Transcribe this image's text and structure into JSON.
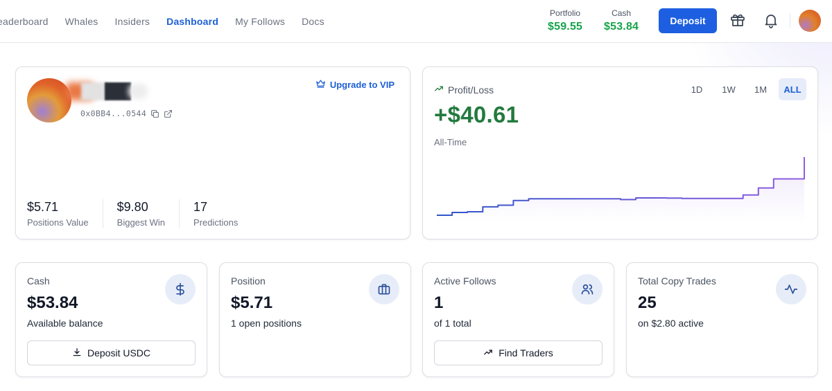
{
  "nav": {
    "links": [
      "eaderboard",
      "Whales",
      "Insiders",
      "Dashboard",
      "My Follows",
      "Docs"
    ],
    "active": "Dashboard"
  },
  "header": {
    "portfolio_label": "Portfolio",
    "portfolio_value": "$59.55",
    "cash_label": "Cash",
    "cash_value": "$53.84",
    "deposit_label": "Deposit",
    "icons": [
      "gift-icon",
      "bell-icon"
    ]
  },
  "profile": {
    "address": "0x0BB4...0544",
    "upgrade_label": "Upgrade to VIP",
    "stats": [
      {
        "value": "$5.71",
        "label": "Positions Value"
      },
      {
        "value": "$9.80",
        "label": "Biggest Win"
      },
      {
        "value": "17",
        "label": "Predictions"
      }
    ]
  },
  "pnl": {
    "title": "Profit/Loss",
    "value": "+$40.61",
    "period": "All-Time",
    "ranges": [
      "1D",
      "1W",
      "1M",
      "ALL"
    ],
    "active_range": "ALL",
    "colors": {
      "line_start": "#2f55c9",
      "line_end": "#8e5ce0",
      "fill": "#efe9fb"
    }
  },
  "chart_data": {
    "type": "line",
    "title": "",
    "xlabel": "",
    "ylabel": "",
    "x": [
      0,
      1,
      2,
      3,
      4,
      5,
      6,
      7,
      8,
      9,
      10,
      11,
      12,
      13,
      14,
      15,
      16,
      17,
      18,
      19,
      20,
      21,
      22,
      23,
      24
    ],
    "series": [
      {
        "values": [
          -1.0,
          1.0,
          1.5,
          5.0,
          6.2,
          9.5,
          10.8,
          10.8,
          10.8,
          10.8,
          10.8,
          10.8,
          10.2,
          11.4,
          11.4,
          11.3,
          11.0,
          11.0,
          11.0,
          11.0,
          13.5,
          18.5,
          25.0,
          25.0,
          40.61
        ]
      }
    ],
    "grid": false,
    "legend": "none"
  },
  "cards": [
    {
      "title": "Cash",
      "value": "$53.84",
      "subtitle": "Available balance",
      "icon": "dollar-icon",
      "action": "Deposit USDC",
      "action_icon": "download-icon"
    },
    {
      "title": "Position",
      "value": "$5.71",
      "subtitle": "1 open positions",
      "icon": "briefcase-icon"
    },
    {
      "title": "Active Follows",
      "value": "1",
      "subtitle": "of 1 total",
      "icon": "users-icon",
      "action": "Find Traders",
      "action_icon": "trending-up-icon"
    },
    {
      "title": "Total Copy Trades",
      "value": "25",
      "subtitle": "on $2.80 active",
      "icon": "activity-icon"
    }
  ]
}
